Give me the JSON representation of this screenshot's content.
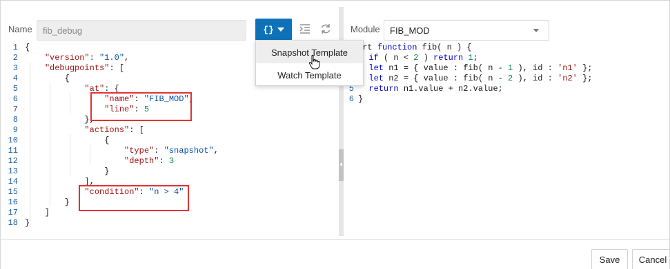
{
  "toolbar": {
    "name_label": "Name",
    "name_value": "fib_debug",
    "template_button_label": "{}",
    "format_icon": "format-indent-icon",
    "refresh_icon": "refresh-icon"
  },
  "template_menu": {
    "items": [
      {
        "label": "Snapshot Template"
      },
      {
        "label": "Watch Template"
      }
    ]
  },
  "editor": {
    "line_numbers": [
      "1",
      "2",
      "3",
      "4",
      "5",
      "6",
      "7",
      "8",
      "9",
      "10",
      "11",
      "12",
      "13",
      "14",
      "15",
      "16",
      "17",
      "18"
    ],
    "lines": [
      "{",
      "    \"version\": \"1.0\",",
      "    \"debugpoints\": [",
      "        {",
      "            \"at\": {",
      "                \"name\": \"FIB_MOD\",",
      "                \"line\": 5",
      "            },",
      "            \"actions\": [",
      "                {",
      "                    \"type\": \"snapshot\",",
      "                    \"depth\": 3",
      "                }",
      "            ],",
      "            \"condition\": \"n > 4\"",
      "        }",
      "    ]",
      "}"
    ]
  },
  "module": {
    "label": "Module",
    "selected": "FIB_MOD",
    "line_numbers": [
      "5",
      "6"
    ],
    "lines": [
      "ort function fib( n ) {",
      "  if ( n < 2 ) return 1;",
      "  let n1 = { value : fib( n - 1 ), id : 'n1' };",
      "  let n2 = { value : fib( n - 2 ), id : 'n2' };",
      "  return n1.value + n2.value;",
      "}"
    ]
  },
  "footer": {
    "save_label": "Save",
    "cancel_label": "Cancel"
  },
  "colors": {
    "accent": "#0f72b9",
    "highlight_box": "#e03232"
  }
}
